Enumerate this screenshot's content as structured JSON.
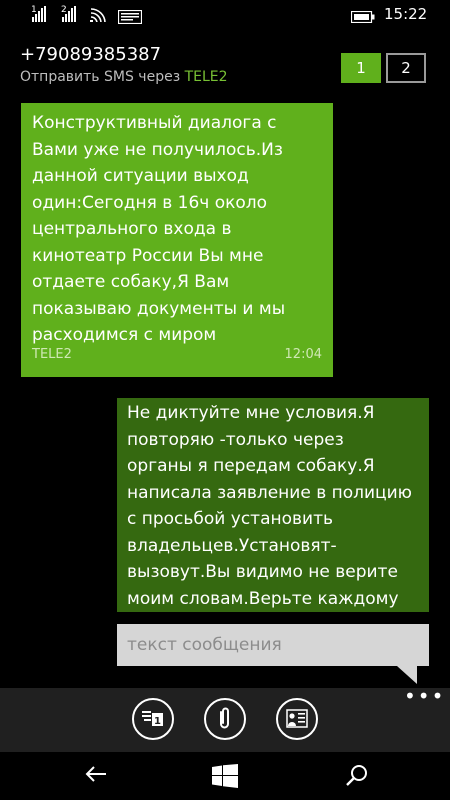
{
  "status": {
    "sim1_label": "1",
    "sim2_label": "2",
    "time": "15:22"
  },
  "header": {
    "contact": "+79089385387",
    "send_via_prefix": "Отправить SMS через ",
    "send_via_carrier": "TELE2",
    "sim_tabs": [
      "1",
      "2"
    ],
    "selected_sim": "1"
  },
  "messages": [
    {
      "direction": "incoming",
      "lines": [
        "Конструктивный диалога с",
        "Вами уже не получилось.Из",
        "данной ситуации выход",
        "один:Сегодня в 16ч около",
        "центрального входа в",
        "кинотеатр России Вы мне",
        "отдаете собаку,Я Вам",
        "показываю документы и мы",
        "расходимся с миром"
      ],
      "carrier": "TELE2",
      "time": "12:04"
    },
    {
      "direction": "outgoing",
      "lines": [
        "Не диктуйте мне условия.Я",
        "повторяю -только через",
        "органы я передам собаку.Я",
        "написала заявление в полицию",
        "с просьбой установить",
        "владельцев.Установят-",
        "вызовут.Вы видимо не верите",
        "моим словам.Верьте каждому"
      ]
    }
  ],
  "compose": {
    "placeholder": "текст сообщения"
  },
  "appbar": {
    "buttons": [
      "sim-switch-icon",
      "attach-icon",
      "contact-card-icon"
    ],
    "more": "•••"
  },
  "navbar": {
    "buttons": [
      "back-icon",
      "windows-start-icon",
      "search-icon"
    ]
  },
  "colors": {
    "incoming_bubble": "#60b01c",
    "outgoing_bubble": "#356910",
    "accent": "#78c034",
    "compose_bg": "#d6d6d6",
    "appbar_bg": "#202020"
  }
}
